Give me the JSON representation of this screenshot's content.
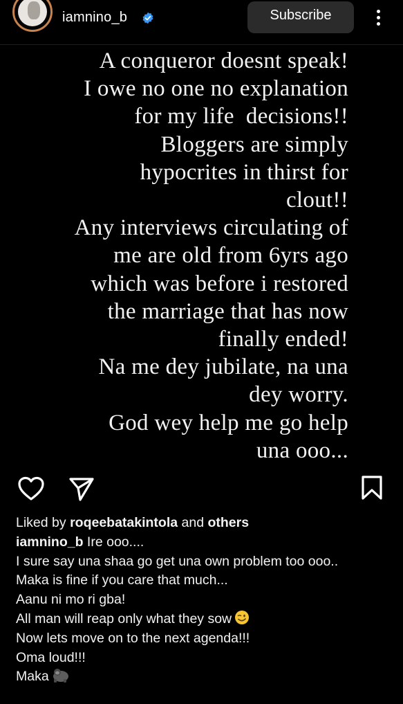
{
  "header": {
    "username": "iamnino_b",
    "subscribe_label": "Subscribe"
  },
  "post": {
    "lines": [
      "A conqueror doesnt speak!",
      "I owe no one no explanation",
      "for my life  decisions!!",
      "Bloggers are simply",
      "hypocrites in thirst for",
      "clout!!",
      "Any interviews circulating of",
      "me are old from 6yrs ago",
      "which was before i restored",
      "the marriage that has now",
      "finally ended!",
      "Na me dey jubilate, na una",
      "dey worry.",
      "God wey help me go help",
      "una ooo..."
    ]
  },
  "actions": {
    "like_icon": "heart-icon",
    "share_icon": "send-icon",
    "save_icon": "bookmark-icon"
  },
  "likes": {
    "prefix": "Liked by ",
    "user": "roqeebatakintola",
    "middle": " and ",
    "others": "others"
  },
  "caption": {
    "username": "iamnino_b",
    "first_line": " Ire ooo....",
    "lines": [
      "I sure say una shaa go get una own problem too ooo..",
      "Maka is fine if you care that much...",
      "Aanu ni mo ri gba!",
      "All man will reap only what they sow",
      "Now lets move on to the next agenda!!!",
      "Oma loud!!!",
      "Maka"
    ],
    "emoji_1": "winking-face-emoji",
    "emoji_2": "gorilla-emoji"
  },
  "colors": {
    "background": "#000000",
    "text": "#f2f2f2",
    "subscribe_bg": "#2b2b2b",
    "verified": "#3897f0",
    "avatar_ring": "#c7834e"
  }
}
